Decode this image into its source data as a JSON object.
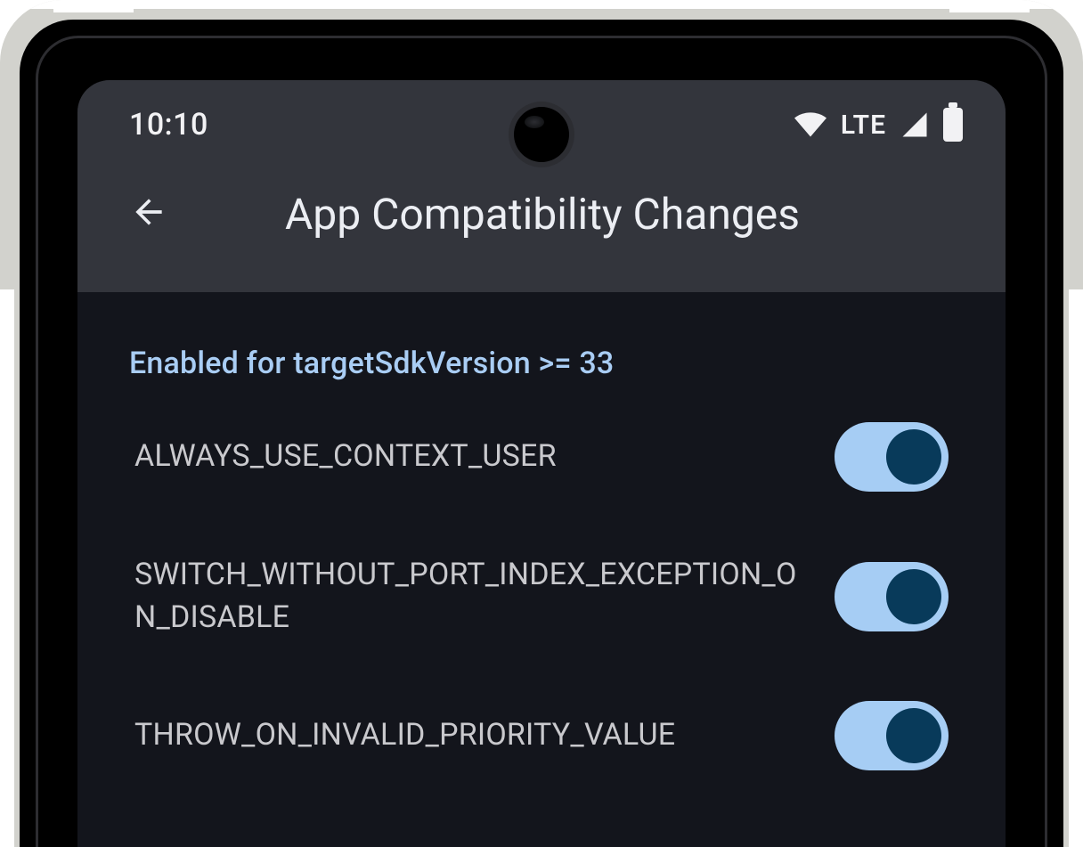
{
  "status_bar": {
    "time": "10:10",
    "network_label": "LTE",
    "wifi_connected": true,
    "signal_full": true,
    "battery_full": true
  },
  "app_bar": {
    "title": "App Compatibility Changes",
    "back_icon": "arrow-back-icon"
  },
  "section": {
    "header": "Enabled for targetSdkVersion >= 33",
    "items": [
      {
        "label": "ALWAYS_USE_CONTEXT_USER",
        "enabled": true
      },
      {
        "label": "SWITCH_WITHOUT_PORT_INDEX_EXCEPTION_ON_DISABLE",
        "enabled": true
      },
      {
        "label": "THROW_ON_INVALID_PRIORITY_VALUE",
        "enabled": true
      }
    ]
  },
  "colors": {
    "accent": "#a6cdf4",
    "thumb_on": "#083a5a",
    "header_text": "#a9cdf4",
    "screen_bg": "#13151c",
    "top_bg": "#33353c"
  }
}
